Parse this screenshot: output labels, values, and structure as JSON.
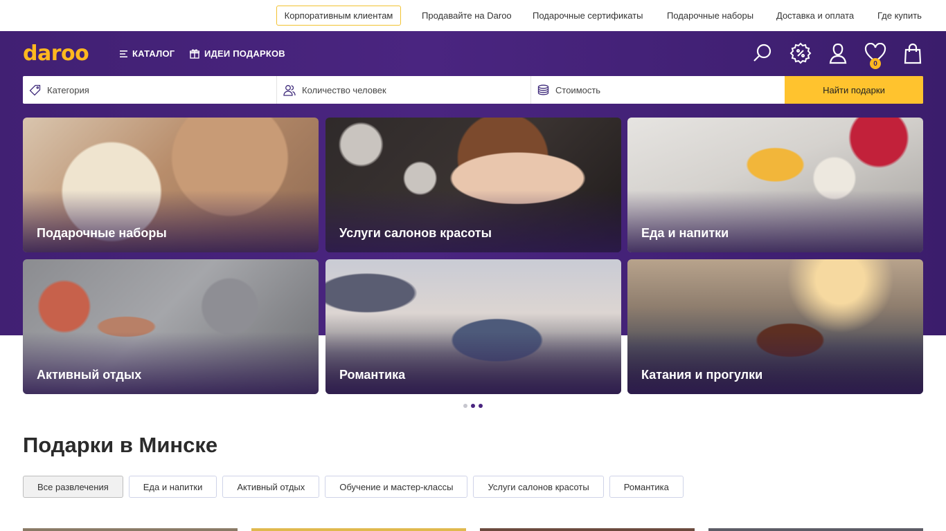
{
  "topbar": {
    "corporate": "Корпоративным клиентам",
    "links": [
      "Продавайте на Daroo",
      "Подарочные сертификаты",
      "Подарочные наборы",
      "Доставка и оплата",
      "Где купить"
    ]
  },
  "header": {
    "logo": "daroo",
    "catalog": "КАТАЛОГ",
    "gift_ideas": "ИДЕИ ПОДАРКОВ",
    "favorites_count": "0",
    "icons": [
      "search-icon",
      "discount-icon",
      "user-icon",
      "heart-icon",
      "bag-icon"
    ]
  },
  "search": {
    "category": "Категория",
    "people": "Количество человек",
    "price": "Стоимость",
    "button": "Найти подарки"
  },
  "categories": [
    "Подарочные наборы",
    "Услуги салонов красоты",
    "Еда и напитки",
    "Активный отдых",
    "Романтика",
    "Катания и прогулки"
  ],
  "section": {
    "title": "Подарки в Минске",
    "filters": [
      "Все развлечения",
      "Еда и напитки",
      "Активный отдых",
      "Обучение и мастер-классы",
      "Услуги салонов красоты",
      "Романтика"
    ]
  },
  "colors": {
    "brand_purple": "#412073",
    "accent_yellow": "#ffc32e",
    "logo_orange": "#ffb81f"
  }
}
